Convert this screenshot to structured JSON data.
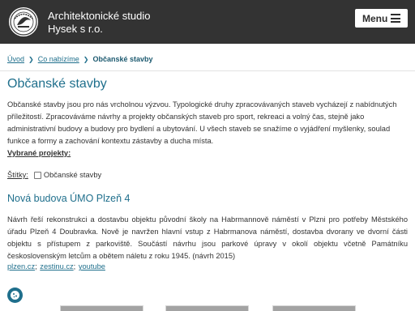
{
  "header": {
    "logo_name": "studio-logo",
    "brand_line1": "Architektonické studio",
    "brand_line2": "Hysek s r.o.",
    "menu_label": "Menu"
  },
  "breadcrumb": {
    "items": [
      "Úvod",
      "Co nabízíme"
    ],
    "current": "Občanské stavby"
  },
  "page": {
    "title": "Občanské stavby",
    "intro": "Občanské stavby jsou pro nás vrcholnou výzvou. Typologické druhy zpracovávaných staveb vycházejí z nabídnutých příležitostí. Zpracováváme návrhy a projekty občanských staveb pro sport, rekreaci a volný čas, stejně jako administrativní budovy a budovy pro bydlení a ubytování. U všech staveb se snažíme o vyjádření myšlenky, soulad funkce a formy a zachování kontextu zástavby a ducha místa.",
    "selected_label": "Vybrané projekty:",
    "tags_label": "Štítky:",
    "tag": "Občanské stavby"
  },
  "project": {
    "title": "Nová budova ÚMO Plzeň 4",
    "description": "Návrh řeší rekonstrukci a dostavbu objektu původní školy na Habrmannově náměstí v Plzni pro potřeby Městského úřadu Plzeň 4 Doubravka. Nově je navržen hlavní vstup z Habrmanova náměstí, dostavba dvorany ve dvorní části objektu s přístupem z parkoviště. Součástí návrhu jsou parkové úpravy v okolí objektu včetně Památníku československým letcům a obětem náletu z roku 1945. (návrh 2015)",
    "links": [
      "plzen.cz",
      "zestinu.cz",
      "youtube"
    ],
    "link_separator": ";"
  },
  "cookie": {
    "icon": "cookie-icon",
    "color": "#1f6f8c"
  },
  "colors": {
    "header_bg": "#333333",
    "accent": "#1f6f8c"
  }
}
